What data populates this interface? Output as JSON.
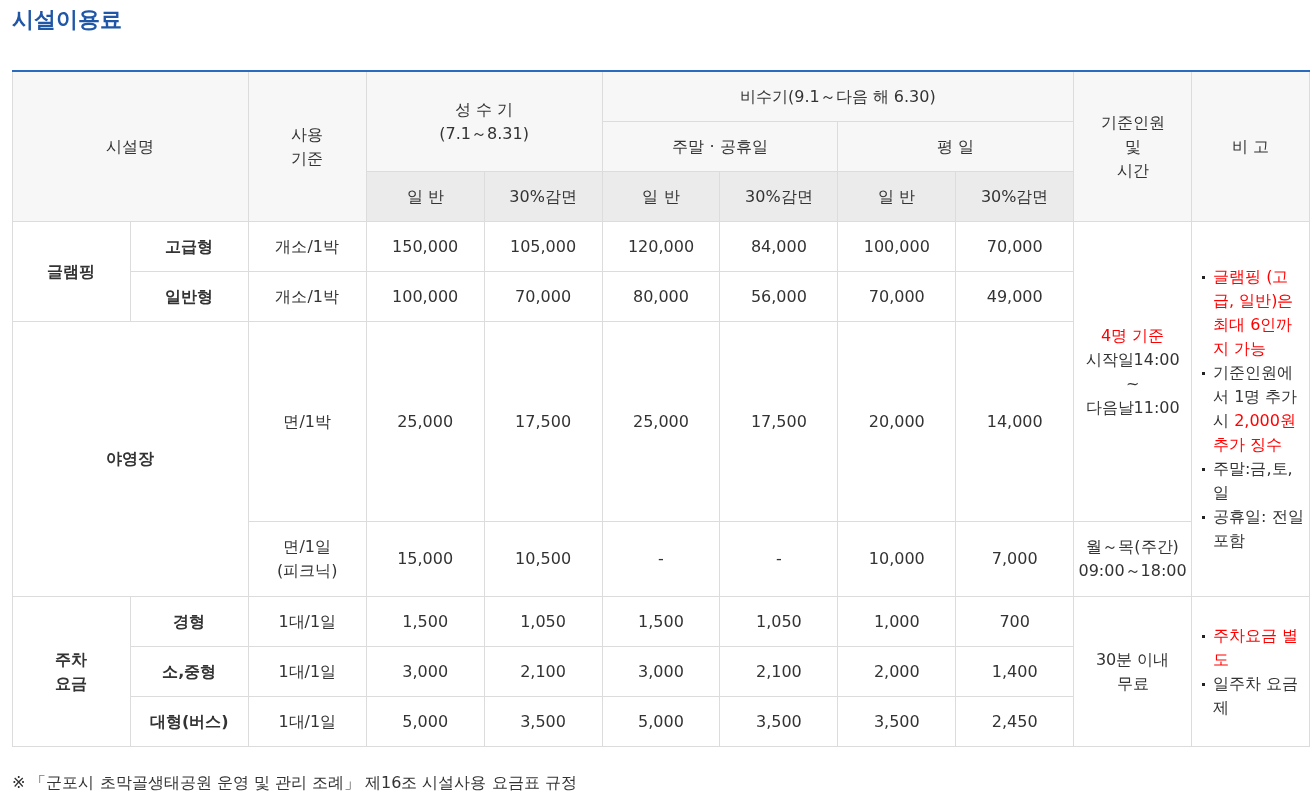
{
  "title": "시설이용료",
  "header": {
    "facility": "시설명",
    "usage": [
      "사용",
      "기준"
    ],
    "peak": [
      "성 수 기",
      "(7.1～8.31)"
    ],
    "offpeak": "비수기(9.1～다음 해 6.30)",
    "offpeak_groups": [
      "주말 · 공휴일",
      "평 일"
    ],
    "subcols": [
      "일 반",
      "30%감면",
      "일 반",
      "30%감면",
      "일 반",
      "30%감면"
    ],
    "basis": [
      "기준인원",
      "및",
      "시간"
    ],
    "remarks": "비 고"
  },
  "groups": [
    {
      "name": [
        "글램핑"
      ],
      "rows": [
        {
          "type": "고급형",
          "unit": [
            "개소/1박"
          ],
          "fees": [
            "150,000",
            "105,000",
            "120,000",
            "84,000",
            "100,000",
            "70,000"
          ],
          "basis": [
            {
              "text": "4명 기준",
              "emphasis": true
            },
            {
              "text": "시작일14:00",
              "emphasis": false
            },
            {
              "text": "~",
              "emphasis": false
            },
            {
              "text": "다음날11:00",
              "emphasis": false
            }
          ],
          "remarks": [
            [
              {
                "text": "글램핑 (고급, 일반)은 최대 6인까지 가능",
                "emphasis": true
              }
            ],
            [
              {
                "text": "기준인원에서 1명 추가시 ",
                "emphasis": false
              },
              {
                "text": "2,000원 추가 징수",
                "emphasis": true
              }
            ],
            [
              {
                "text": "주말:금,토,일",
                "emphasis": false
              }
            ],
            [
              {
                "text": "공휴일: 전일포함",
                "emphasis": false
              }
            ]
          ]
        },
        {
          "type": "일반형",
          "unit": [
            "개소/1박"
          ],
          "fees": [
            "100,000",
            "70,000",
            "80,000",
            "56,000",
            "70,000",
            "49,000"
          ]
        }
      ]
    },
    {
      "name": [
        "야영장"
      ],
      "rows": [
        {
          "unit": [
            "면/1박"
          ],
          "fees": [
            "25,000",
            "17,500",
            "25,000",
            "17,500",
            "20,000",
            "14,000"
          ]
        },
        {
          "unit": [
            "면/1일",
            "(피크닉)"
          ],
          "fees": [
            "15,000",
            "10,500",
            "-",
            "-",
            "10,000",
            "7,000"
          ],
          "basis": [
            {
              "text": "월～목(주간)",
              "emphasis": false
            },
            {
              "text": "09:00～18:00",
              "emphasis": false
            }
          ]
        }
      ]
    },
    {
      "name": [
        "주차",
        "요금"
      ],
      "rows": [
        {
          "type": "경형",
          "unit": [
            "1대/1일"
          ],
          "fees": [
            "1,500",
            "1,050",
            "1,500",
            "1,050",
            "1,000",
            "700"
          ],
          "basis": [
            {
              "text": "30분 이내",
              "emphasis": false
            },
            {
              "text": "무료",
              "emphasis": false
            }
          ],
          "remarks": [
            [
              {
                "text": "주차요금 별도",
                "emphasis": true
              }
            ],
            [
              {
                "text": "일주차 요금제",
                "emphasis": false
              }
            ]
          ]
        },
        {
          "type": "소,중형",
          "unit": [
            "1대/1일"
          ],
          "fees": [
            "3,000",
            "2,100",
            "3,000",
            "2,100",
            "2,000",
            "1,400"
          ]
        },
        {
          "type": "대형(버스)",
          "unit": [
            "1대/1일"
          ],
          "fees": [
            "5,000",
            "3,500",
            "5,000",
            "3,500",
            "3,500",
            "2,450"
          ]
        }
      ]
    }
  ],
  "footnote": "※ 「군포시 초막골생태공원 운영 및 관리 조례」 제16조 시설사용 요금표 규정"
}
